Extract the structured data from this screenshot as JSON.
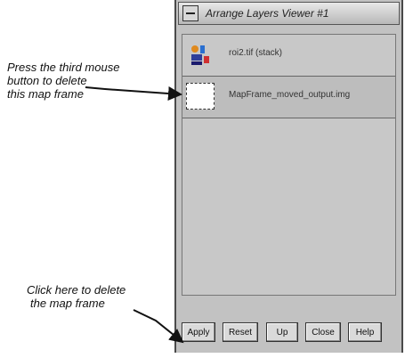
{
  "annotations": {
    "delete_frame": [
      "Press the third mouse",
      "button to delete",
      "this map frame"
    ],
    "click_here": [
      "Click here to delete",
      "the map frame"
    ]
  },
  "window": {
    "title": "Arrange Layers Viewer #1",
    "rows": [
      {
        "label": "roi2.tif (stack)",
        "icon": "layer-stack-icon"
      },
      {
        "label": "MapFrame_moved_output.img",
        "icon": "map-frame-icon"
      }
    ],
    "buttons": {
      "apply": "Apply",
      "reset": "Reset",
      "up": "Up",
      "close": "Close",
      "help": "Help"
    }
  }
}
